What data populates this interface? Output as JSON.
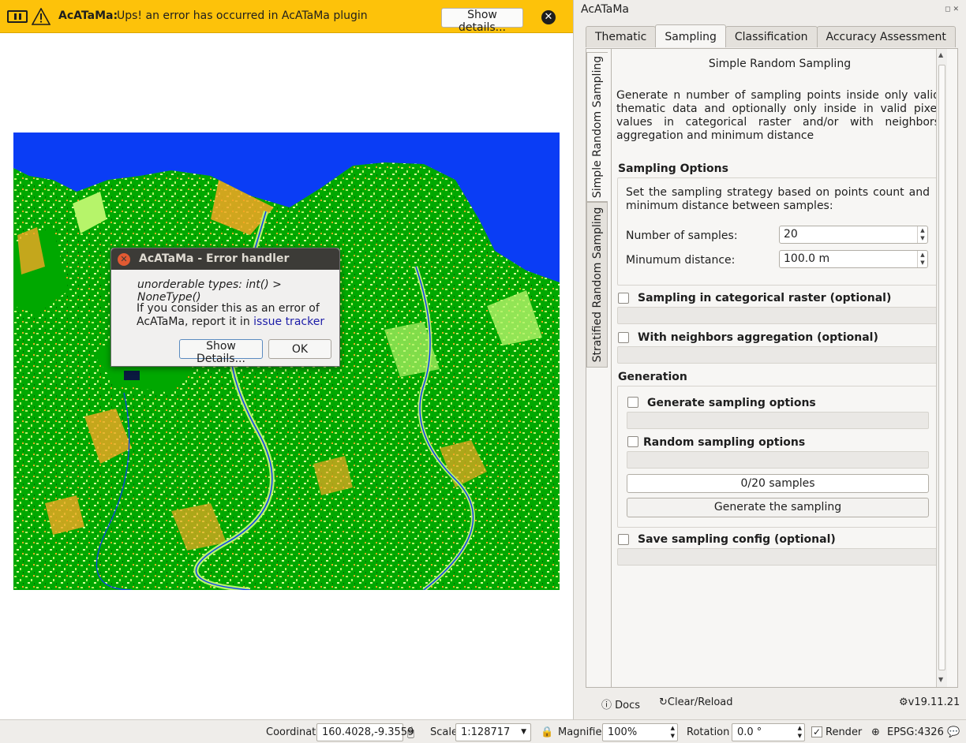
{
  "colors": {
    "message_bar": "#fdc20a",
    "map_water": "#0a3df5",
    "map_forest": "#00a800",
    "map_light": "#b6f46a",
    "map_orange": "#f5a623",
    "dialog_title": "#3c3b37",
    "link": "#1c1ca8"
  },
  "message_bar": {
    "title": "AcATaMa:",
    "message": "Ups! an error has occurred in AcATaMa plugin",
    "details_button": "Show details...",
    "icons": [
      "pause-icon",
      "warning-icon",
      "close-icon"
    ]
  },
  "dialog": {
    "title": "AcATaMa - Error handler",
    "error": "unorderable types: int() > NoneType()",
    "body_prefix": "If you consider this as an error of AcATaMa, report it in ",
    "link": "issue tracker",
    "show_details": "Show Details...",
    "ok": "OK"
  },
  "dock": {
    "title": "AcATaMa",
    "tabs": [
      "Thematic",
      "Sampling",
      "Classification",
      "Accuracy Assessment"
    ],
    "active_tab": "Sampling",
    "vertical_tabs": [
      "Simple Random Sampling",
      "Stratified Random Sampling"
    ],
    "heading": "Simple Random Sampling",
    "description": "Generate n number of sampling points inside only valid thematic data and optionally only inside in valid pixel values in categorical raster and/or with neighbors aggregation and minimum distance",
    "sampling_options": {
      "title": "Sampling Options",
      "text": "Set the sampling strategy based on points count and minimum distance between samples:",
      "num_samples_label": "Number of samples:",
      "num_samples_value": "20",
      "min_distance_label": "Minumum distance:",
      "min_distance_value": "100.0 m"
    },
    "categorical": "Sampling in categorical raster (optional)",
    "neighbors": "With neighbors aggregation (optional)",
    "generation": {
      "title": "Generation",
      "generate_options": "Generate sampling options",
      "random_options": "Random sampling options",
      "progress": "0/20 samples",
      "generate_button": "Generate the sampling"
    },
    "save_config": "Save sampling config (optional)",
    "footer": {
      "docs": "Docs",
      "clear": "Clear/Reload",
      "version": "v19.11.21"
    }
  },
  "status": {
    "coordinate_label": "Coordinate",
    "coordinate_value": "160.4028,-9.3559",
    "scale_label": "Scale",
    "scale_value": "1:128717",
    "magnifier_label": "Magnifier",
    "magnifier_value": "100%",
    "rotation_label": "Rotation",
    "rotation_value": "0.0 °",
    "render_label": "Render",
    "crs": "EPSG:4326"
  }
}
